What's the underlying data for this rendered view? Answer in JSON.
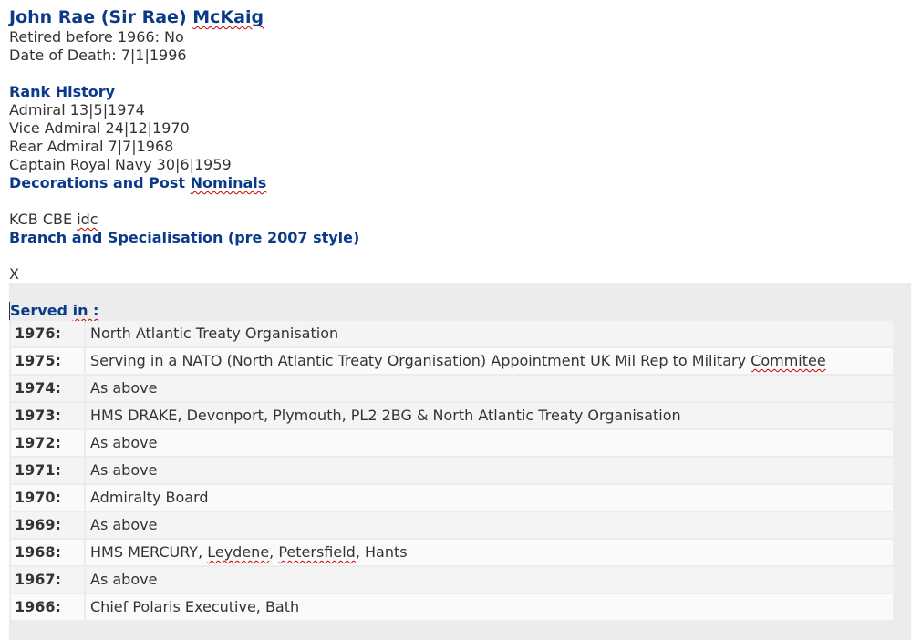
{
  "officer": {
    "name_plain": "John Rae (Sir Rae) ",
    "name_surname": "McKaig",
    "retired_line": "Retired before 1966: No",
    "death_line": "Date of Death: 7|1|1996"
  },
  "rank_history": {
    "heading": "Rank History",
    "items": [
      "Admiral 13|5|1974",
      "Vice Admiral 24|12|1970",
      "Rear Admiral 7|7|1968",
      "Captain Royal Navy 30|6|1959"
    ]
  },
  "decorations": {
    "heading_plain": "Decorations and Post ",
    "heading_marked": "Nominals",
    "value_plain": "KCB CBE ",
    "value_marked": "idc"
  },
  "branch": {
    "heading": "Branch and Specialisation (pre 2007 style)",
    "value": "X"
  },
  "served": {
    "label_plain": "Served ",
    "label_marked": "in :",
    "rows": [
      {
        "year": "1976:",
        "unit": "North Atlantic Treaty Organisation"
      },
      {
        "year": "1975:",
        "unit_plain": "Serving in a NATO (North Atlantic Treaty Organisation) Appointment UK Mil Rep to Military ",
        "unit_marked": "Commitee"
      },
      {
        "year": "1974:",
        "unit": "As above"
      },
      {
        "year": "1973:",
        "unit": "HMS DRAKE, Devonport, Plymouth, PL2 2BG & North Atlantic Treaty Organisation"
      },
      {
        "year": "1972:",
        "unit": "As above"
      },
      {
        "year": "1971:",
        "unit": "As above"
      },
      {
        "year": "1970:",
        "unit": "Admiralty Board"
      },
      {
        "year": "1969:",
        "unit": "As above"
      },
      {
        "year": "1968:",
        "unit_a": "HMS MERCURY, ",
        "unit_b": "Leydene",
        "unit_c": ", ",
        "unit_d": "Petersfield",
        "unit_e": ", Hants"
      },
      {
        "year": "1967:",
        "unit": "As above"
      },
      {
        "year": "1966:",
        "unit": "Chief Polaris Executive, Bath"
      }
    ]
  }
}
